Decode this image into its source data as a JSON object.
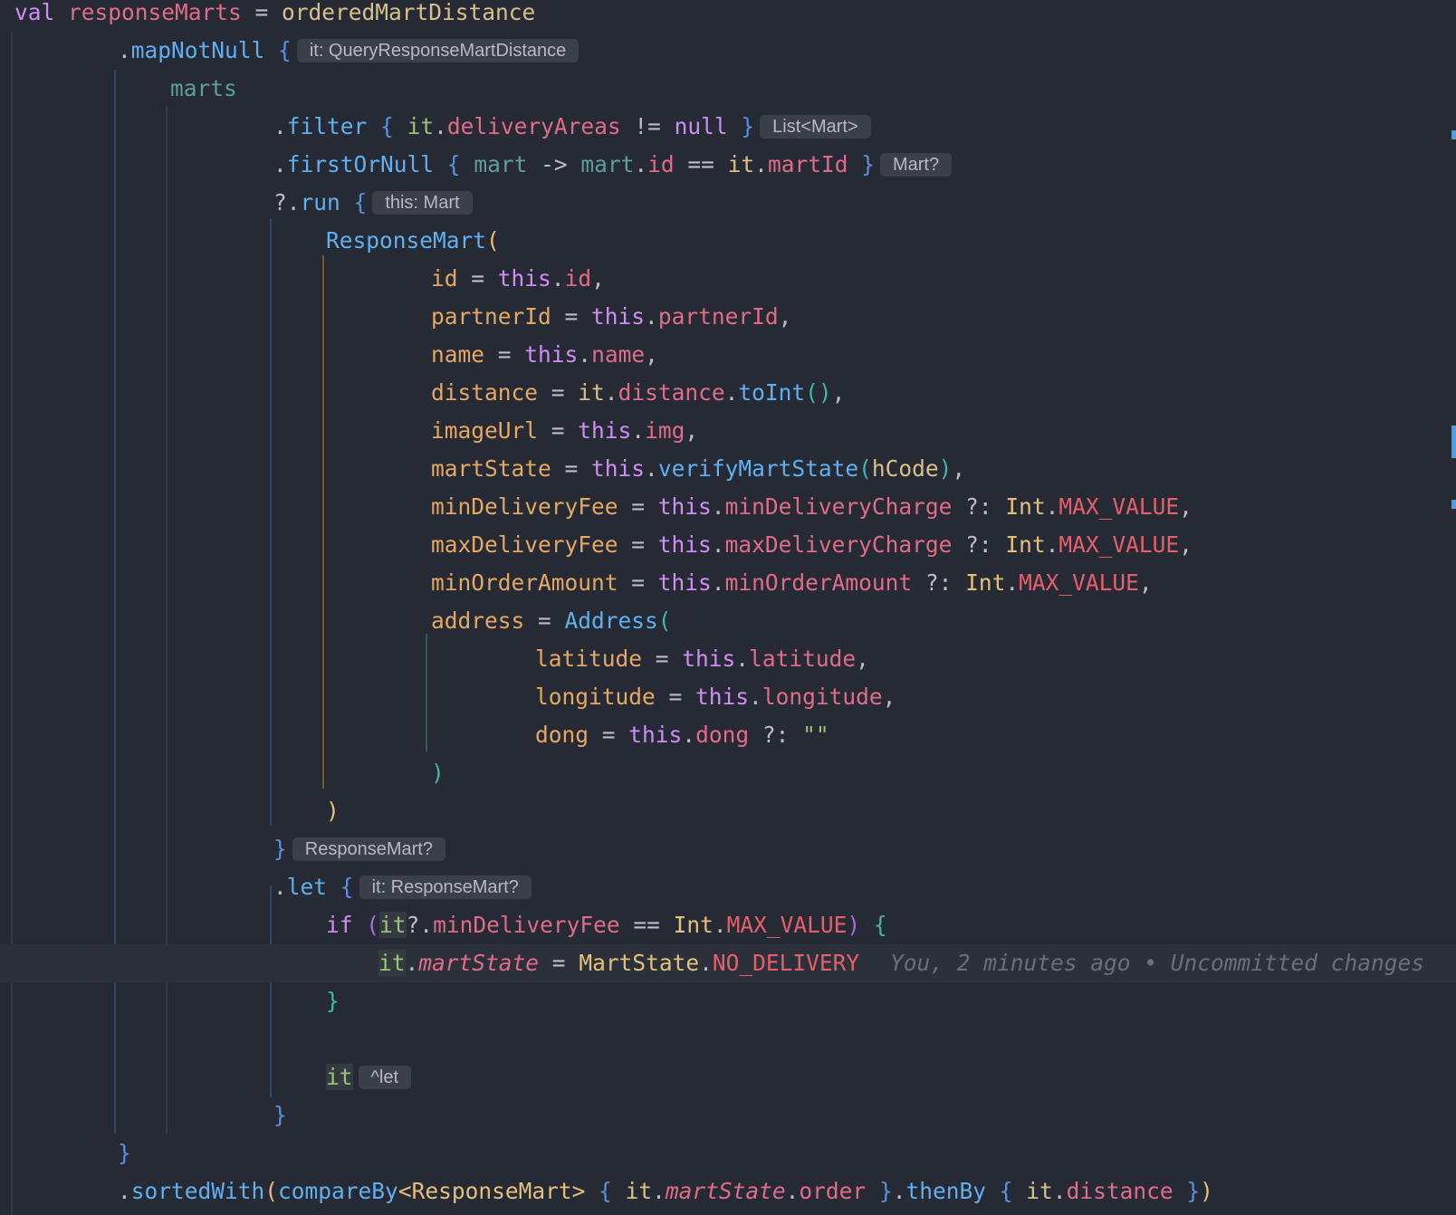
{
  "editor": {
    "language": "Kotlin",
    "lines": [
      {
        "indent": 16,
        "tokens": [
          [
            "kw",
            "val "
          ],
          [
            "pvar",
            "responseMarts"
          ],
          [
            "op",
            " = "
          ],
          [
            "arg",
            "orderedMartDistance"
          ]
        ]
      },
      {
        "indent": 130,
        "tokens": [
          [
            "op",
            "."
          ],
          [
            "fn",
            "mapNotNull"
          ],
          [
            "op",
            " "
          ],
          [
            "b1",
            "{"
          ]
        ],
        "hint": "it: QueryResponseMartDistance"
      },
      {
        "indent": 188,
        "tokens": [
          [
            "lvar",
            "marts"
          ]
        ]
      },
      {
        "indent": 302,
        "tokens": [
          [
            "op",
            "."
          ],
          [
            "fn",
            "filter"
          ],
          [
            "op",
            " "
          ],
          [
            "b1",
            "{ "
          ],
          [
            "it",
            "it"
          ],
          [
            "op",
            "."
          ],
          [
            "prop",
            "deliveryAreas"
          ],
          [
            "op",
            " != "
          ],
          [
            "kw",
            "null"
          ],
          [
            "op",
            " "
          ],
          [
            "b1",
            "}"
          ]
        ],
        "hint": "List<Mart>"
      },
      {
        "indent": 302,
        "tokens": [
          [
            "op",
            "."
          ],
          [
            "fn",
            "firstOrNull"
          ],
          [
            "op",
            " "
          ],
          [
            "b1",
            "{ "
          ],
          [
            "lvar",
            "mart"
          ],
          [
            "op",
            " -> "
          ],
          [
            "lvar",
            "mart"
          ],
          [
            "op",
            "."
          ],
          [
            "prop",
            "id"
          ],
          [
            "op",
            " == "
          ],
          [
            "arg",
            "it"
          ],
          [
            "op",
            "."
          ],
          [
            "prop",
            "martId"
          ],
          [
            "op",
            " "
          ],
          [
            "b1",
            "}"
          ]
        ],
        "hint": "Mart?"
      },
      {
        "indent": 302,
        "tokens": [
          [
            "op",
            "?."
          ],
          [
            "fn",
            "run"
          ],
          [
            "op",
            " "
          ],
          [
            "b1",
            "{"
          ]
        ],
        "hint": "this: Mart"
      },
      {
        "indent": 360,
        "tokens": [
          [
            "cls",
            "ResponseMart"
          ],
          [
            "b2",
            "("
          ]
        ]
      },
      {
        "indent": 476,
        "tokens": [
          [
            "par",
            "id"
          ],
          [
            "op",
            " = "
          ],
          [
            "kw",
            "this"
          ],
          [
            "op",
            "."
          ],
          [
            "prop",
            "id"
          ],
          [
            "op",
            ","
          ]
        ]
      },
      {
        "indent": 476,
        "tokens": [
          [
            "par",
            "partnerId"
          ],
          [
            "op",
            " = "
          ],
          [
            "kw",
            "this"
          ],
          [
            "op",
            "."
          ],
          [
            "prop",
            "partnerId"
          ],
          [
            "op",
            ","
          ]
        ]
      },
      {
        "indent": 476,
        "tokens": [
          [
            "par",
            "name"
          ],
          [
            "op",
            " = "
          ],
          [
            "kw",
            "this"
          ],
          [
            "op",
            "."
          ],
          [
            "prop",
            "name"
          ],
          [
            "op",
            ","
          ]
        ]
      },
      {
        "indent": 476,
        "tokens": [
          [
            "par",
            "distance"
          ],
          [
            "op",
            " = "
          ],
          [
            "arg",
            "it"
          ],
          [
            "op",
            "."
          ],
          [
            "prop",
            "distance"
          ],
          [
            "op",
            "."
          ],
          [
            "fn",
            "toInt"
          ],
          [
            "b3",
            "()"
          ],
          [
            "op",
            ","
          ]
        ]
      },
      {
        "indent": 476,
        "tokens": [
          [
            "par",
            "imageUrl"
          ],
          [
            "op",
            " = "
          ],
          [
            "kw",
            "this"
          ],
          [
            "op",
            "."
          ],
          [
            "prop",
            "img"
          ],
          [
            "op",
            ","
          ]
        ]
      },
      {
        "indent": 476,
        "tokens": [
          [
            "par",
            "martState"
          ],
          [
            "op",
            " = "
          ],
          [
            "kw",
            "this"
          ],
          [
            "op",
            "."
          ],
          [
            "fn",
            "verifyMartState"
          ],
          [
            "b3",
            "("
          ],
          [
            "arg",
            "hCode"
          ],
          [
            "b3",
            ")"
          ],
          [
            "op",
            ","
          ]
        ]
      },
      {
        "indent": 476,
        "tokens": [
          [
            "par",
            "minDeliveryFee"
          ],
          [
            "op",
            " = "
          ],
          [
            "kw",
            "this"
          ],
          [
            "op",
            "."
          ],
          [
            "prop",
            "minDeliveryCharge"
          ],
          [
            "op",
            " ?: "
          ],
          [
            "typ",
            "Int"
          ],
          [
            "op",
            "."
          ],
          [
            "const",
            "MAX_VALUE"
          ],
          [
            "op",
            ","
          ]
        ]
      },
      {
        "indent": 476,
        "tokens": [
          [
            "par",
            "maxDeliveryFee"
          ],
          [
            "op",
            " = "
          ],
          [
            "kw",
            "this"
          ],
          [
            "op",
            "."
          ],
          [
            "prop",
            "maxDeliveryCharge"
          ],
          [
            "op",
            " ?: "
          ],
          [
            "typ",
            "Int"
          ],
          [
            "op",
            "."
          ],
          [
            "const",
            "MAX_VALUE"
          ],
          [
            "op",
            ","
          ]
        ]
      },
      {
        "indent": 476,
        "tokens": [
          [
            "par",
            "minOrderAmount"
          ],
          [
            "op",
            " = "
          ],
          [
            "kw",
            "this"
          ],
          [
            "op",
            "."
          ],
          [
            "prop",
            "minOrderAmount"
          ],
          [
            "op",
            " ?: "
          ],
          [
            "typ",
            "Int"
          ],
          [
            "op",
            "."
          ],
          [
            "const",
            "MAX_VALUE"
          ],
          [
            "op",
            ","
          ]
        ]
      },
      {
        "indent": 476,
        "tokens": [
          [
            "par",
            "address"
          ],
          [
            "op",
            " = "
          ],
          [
            "cls",
            "Address"
          ],
          [
            "b3",
            "("
          ]
        ]
      },
      {
        "indent": 591,
        "tokens": [
          [
            "par",
            "latitude"
          ],
          [
            "op",
            " = "
          ],
          [
            "kw",
            "this"
          ],
          [
            "op",
            "."
          ],
          [
            "prop",
            "latitude"
          ],
          [
            "op",
            ","
          ]
        ]
      },
      {
        "indent": 591,
        "tokens": [
          [
            "par",
            "longitude"
          ],
          [
            "op",
            " = "
          ],
          [
            "kw",
            "this"
          ],
          [
            "op",
            "."
          ],
          [
            "prop",
            "longitude"
          ],
          [
            "op",
            ","
          ]
        ]
      },
      {
        "indent": 591,
        "tokens": [
          [
            "par",
            "dong"
          ],
          [
            "op",
            " = "
          ],
          [
            "kw",
            "this"
          ],
          [
            "op",
            "."
          ],
          [
            "prop",
            "dong"
          ],
          [
            "op",
            " ?: "
          ],
          [
            "str",
            "\"\""
          ]
        ]
      },
      {
        "indent": 476,
        "tokens": [
          [
            "b3",
            ")"
          ]
        ]
      },
      {
        "indent": 360,
        "tokens": [
          [
            "b2",
            ")"
          ]
        ]
      },
      {
        "indent": 302,
        "tokens": [
          [
            "b1",
            "}"
          ]
        ],
        "hint": "ResponseMart?"
      },
      {
        "indent": 302,
        "tokens": [
          [
            "op",
            "."
          ],
          [
            "fn",
            "let"
          ],
          [
            "op",
            " "
          ],
          [
            "b1",
            "{"
          ]
        ],
        "hint": "it: ResponseMart?"
      },
      {
        "indent": 360,
        "tokens": [
          [
            "kw",
            "if "
          ],
          [
            "b4",
            "("
          ],
          [
            "it",
            "it",
            "hl"
          ],
          [
            "op",
            "?."
          ],
          [
            "prop",
            "minDeliveryFee"
          ],
          [
            "op",
            " == "
          ],
          [
            "typ",
            "Int"
          ],
          [
            "op",
            "."
          ],
          [
            "const",
            "MAX_VALUE"
          ],
          [
            "b4",
            ")"
          ],
          [
            "op",
            " "
          ],
          [
            "b3",
            "{"
          ]
        ]
      },
      {
        "indent": 418,
        "tokens": [
          [
            "it",
            "it",
            "hl"
          ],
          [
            "op",
            "."
          ],
          [
            "iprop",
            "martState"
          ],
          [
            "op",
            " = "
          ],
          [
            "typ",
            "MartState"
          ],
          [
            "op",
            "."
          ],
          [
            "const",
            "NO_DELIVERY"
          ]
        ],
        "current": true,
        "blame": "You, 2 minutes ago • Uncommitted changes"
      },
      {
        "indent": 360,
        "tokens": [
          [
            "b3",
            "}"
          ]
        ]
      },
      {
        "indent": 360,
        "tokens": []
      },
      {
        "indent": 360,
        "tokens": [
          [
            "it",
            "it",
            "hl"
          ]
        ],
        "hint": "^let"
      },
      {
        "indent": 302,
        "tokens": [
          [
            "b1",
            "}"
          ]
        ]
      },
      {
        "indent": 130,
        "tokens": [
          [
            "b1",
            "}"
          ]
        ]
      },
      {
        "indent": 130,
        "tokens": [
          [
            "op",
            "."
          ],
          [
            "fn",
            "sortedWith"
          ],
          [
            "b2",
            "("
          ],
          [
            "fn",
            "compareBy"
          ],
          [
            "typ",
            "<ResponseMart>"
          ],
          [
            "op",
            " "
          ],
          [
            "b1",
            "{ "
          ],
          [
            "arg",
            "it"
          ],
          [
            "op",
            "."
          ],
          [
            "iprop",
            "martState"
          ],
          [
            "op",
            "."
          ],
          [
            "prop",
            "order"
          ],
          [
            "op",
            " "
          ],
          [
            "b1",
            "}"
          ],
          [
            "op",
            "."
          ],
          [
            "fn",
            "thenBy"
          ],
          [
            "op",
            " "
          ],
          [
            "b1",
            "{ "
          ],
          [
            "arg",
            "it"
          ],
          [
            "op",
            "."
          ],
          [
            "prop",
            "distance"
          ],
          [
            "op",
            " "
          ],
          [
            "b1",
            "}"
          ],
          [
            "b2",
            ")"
          ]
        ]
      }
    ]
  }
}
